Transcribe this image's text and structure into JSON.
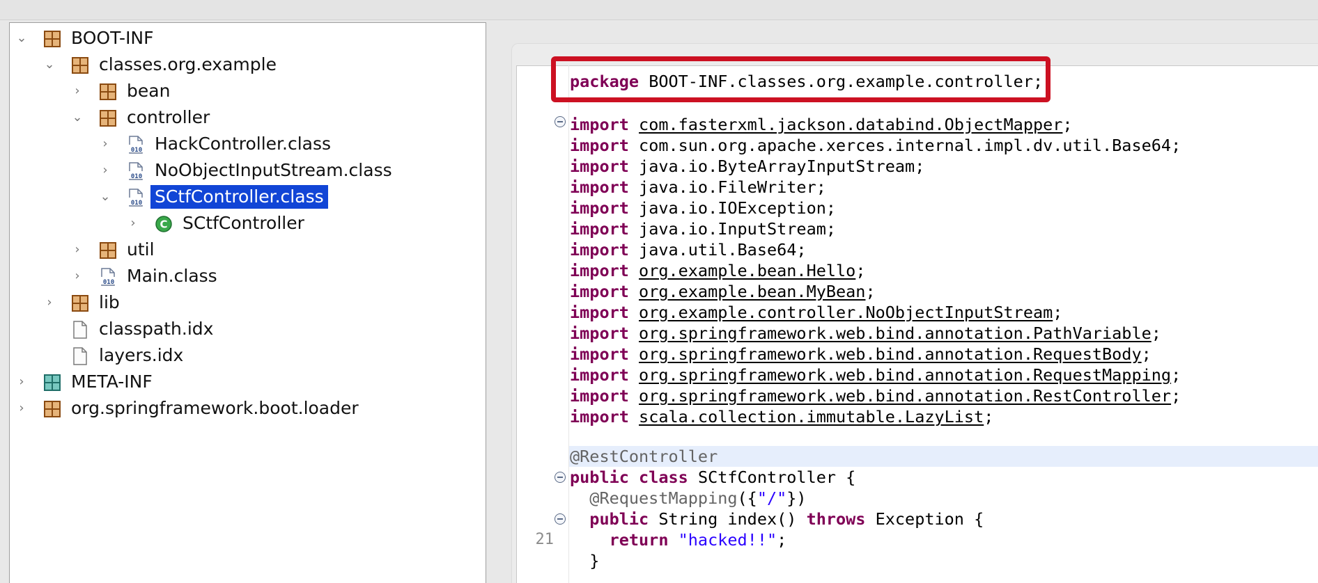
{
  "tree": {
    "items": [
      {
        "label": "BOOT-INF",
        "icon": "package-icon",
        "chevron": "down",
        "selected": false
      },
      {
        "label": "classes.org.example",
        "icon": "package-icon",
        "chevron": "down",
        "selected": false
      },
      {
        "label": "bean",
        "icon": "package-icon",
        "chevron": "right",
        "selected": false
      },
      {
        "label": "controller",
        "icon": "package-icon",
        "chevron": "down",
        "selected": false
      },
      {
        "label": "HackController.class",
        "icon": "class-file-icon",
        "chevron": "right",
        "selected": false
      },
      {
        "label": "NoObjectInputStream.class",
        "icon": "class-file-icon",
        "chevron": "right",
        "selected": false
      },
      {
        "label": "SCtfController.class",
        "icon": "class-file-icon",
        "chevron": "down",
        "selected": true
      },
      {
        "label": "SCtfController",
        "icon": "class-icon",
        "chevron": "right",
        "selected": false
      },
      {
        "label": "util",
        "icon": "package-icon",
        "chevron": "right",
        "selected": false
      },
      {
        "label": "Main.class",
        "icon": "class-file-icon",
        "chevron": "right",
        "selected": false
      },
      {
        "label": "lib",
        "icon": "package-icon",
        "chevron": "right",
        "selected": false
      },
      {
        "label": "classpath.idx",
        "icon": "file-icon",
        "chevron": "",
        "selected": false
      },
      {
        "label": "layers.idx",
        "icon": "file-icon",
        "chevron": "",
        "selected": false
      },
      {
        "label": "META-INF",
        "icon": "folder-package-icon",
        "chevron": "right",
        "selected": false
      },
      {
        "label": "org.springframework.boot.loader",
        "icon": "package-icon",
        "chevron": "right",
        "selected": false
      }
    ]
  },
  "editor": {
    "package_keyword": "package",
    "package_name": " BOOT-INF.classes.org.example.controller;",
    "imports": [
      {
        "kw": "import",
        "name": "com.fasterxml.jackson.databind.ObjectMapper",
        "linked": true
      },
      {
        "kw": "import",
        "name": "com.sun.org.apache.xerces.internal.impl.dv.util.Base64",
        "linked": false
      },
      {
        "kw": "import",
        "name": "java.io.ByteArrayInputStream",
        "linked": false
      },
      {
        "kw": "import",
        "name": "java.io.FileWriter",
        "linked": false
      },
      {
        "kw": "import",
        "name": "java.io.IOException",
        "linked": false
      },
      {
        "kw": "import",
        "name": "java.io.InputStream",
        "linked": false
      },
      {
        "kw": "import",
        "name": "java.util.Base64",
        "linked": false
      },
      {
        "kw": "import",
        "name": "org.example.bean.Hello",
        "linked": true
      },
      {
        "kw": "import",
        "name": "org.example.bean.MyBean",
        "linked": true
      },
      {
        "kw": "import",
        "name": "org.example.controller.NoObjectInputStream",
        "linked": true
      },
      {
        "kw": "import",
        "name": "org.springframework.web.bind.annotation.PathVariable",
        "linked": true
      },
      {
        "kw": "import",
        "name": "org.springframework.web.bind.annotation.RequestBody",
        "linked": true
      },
      {
        "kw": "import",
        "name": "org.springframework.web.bind.annotation.RequestMapping",
        "linked": true
      },
      {
        "kw": "import",
        "name": "org.springframework.web.bind.annotation.RestController",
        "linked": true
      },
      {
        "kw": "import",
        "name": "scala.collection.immutable.LazyList",
        "linked": true
      }
    ],
    "semicolon": ";",
    "annotation_rest": "@RestController",
    "class_kw1": "public",
    "class_kw2": "class",
    "class_rest": " SCtfController {",
    "mapping_annotation": "@RequestMapping",
    "mapping_open": "({",
    "mapping_string": "\"/\"",
    "mapping_close": "})",
    "method_kw1": "public",
    "method_mid": " String index() ",
    "method_kw2": "throws",
    "method_rest": " Exception {",
    "return_kw": "return",
    "return_string": "\"hacked!!\"",
    "return_end": ";",
    "close_brace": "}",
    "line_number": "21"
  }
}
